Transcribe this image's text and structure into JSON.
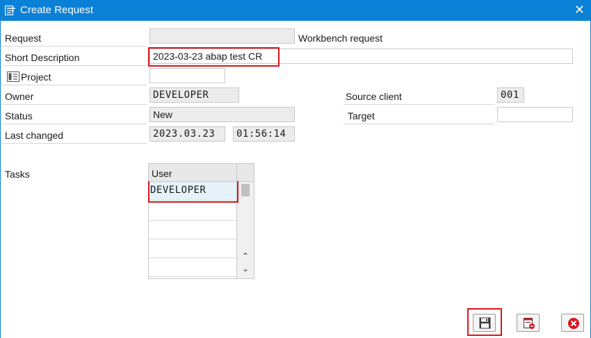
{
  "window": {
    "title": "Create Request",
    "icons": {
      "title": "request-icon",
      "close": "close-icon"
    }
  },
  "form": {
    "request_label": "Request",
    "request_value": "",
    "request_type": "Workbench request",
    "short_description_label": "Short Description",
    "short_description_value": "2023-03-23 abap test CR",
    "project_label": "Project",
    "project_value": "",
    "owner_label": "Owner",
    "owner_value": "DEVELOPER",
    "source_client_label": "Source client",
    "source_client_value": "001",
    "status_label": "Status",
    "status_value": "New",
    "target_label": "Target",
    "target_value": "",
    "last_changed_label": "Last changed",
    "last_changed_date": "2023.03.23",
    "last_changed_time": "01:56:14",
    "tasks_label": "Tasks"
  },
  "tasks_table": {
    "header": "User",
    "rows": [
      "DEVELOPER",
      "",
      "",
      "",
      ""
    ]
  },
  "buttons": {
    "save": "save-icon",
    "delete_entry": "delete-entry-icon",
    "cancel": "cancel-icon"
  },
  "colors": {
    "titlebar": "#0a80d6",
    "focus": "#d6161d",
    "readonly": "#ececec",
    "cancel": "#d6161d"
  }
}
